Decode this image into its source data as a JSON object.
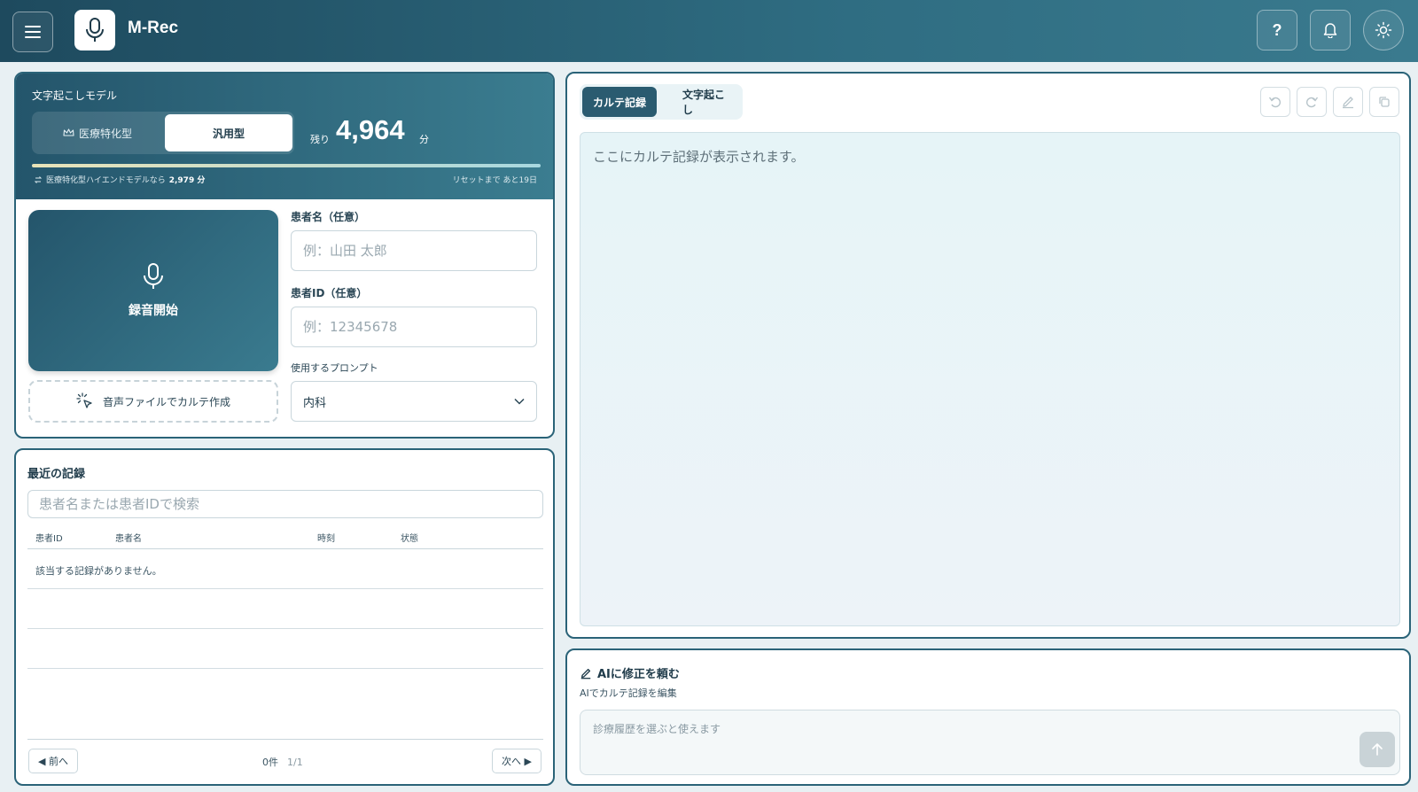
{
  "header": {
    "app_title": "M-Rec",
    "help_label": "?"
  },
  "model": {
    "label": "文字起こしモデル",
    "options": [
      "医療特化型",
      "汎用型"
    ],
    "selected": "汎用型",
    "remaining_prefix": "残り",
    "remaining_value": "4,964",
    "remaining_unit": "分",
    "progress_fraction": 1.0,
    "hint_prefix": "医療特化型ハイエンドモデルなら",
    "hint_value": "2,979 分",
    "reset_text": "リセットまで あと19日"
  },
  "recorder": {
    "record_label": "録音開始",
    "file_label": "音声ファイルでカルテ作成"
  },
  "patient_form": {
    "name_label": "患者名（任意）",
    "name_placeholder": "例：山田 太郎",
    "id_label": "患者ID（任意）",
    "id_placeholder": "例：12345678",
    "prompt_label": "使用するプロンプト",
    "prompt_value": "内科"
  },
  "recent": {
    "title": "最近の記録",
    "search_placeholder": "患者名または患者IDで検索",
    "columns": [
      "患者ID",
      "患者名",
      "時刻",
      "状態"
    ],
    "empty_text": "該当する記録がありません。",
    "prev_label": "◀ 前へ",
    "next_label": "次へ ▶",
    "count": "0件",
    "page": "1/1"
  },
  "main": {
    "tabs": [
      "カルテ記録",
      "文字起こし"
    ],
    "active_tab": "カルテ記録",
    "placeholder": "ここにカルテ記録が表示されます。"
  },
  "ai": {
    "title": "AIに修正を頼む",
    "subtitle": "AIでカルテ記録を編集",
    "input_placeholder": "診療履歴を選ぶと使えます"
  }
}
